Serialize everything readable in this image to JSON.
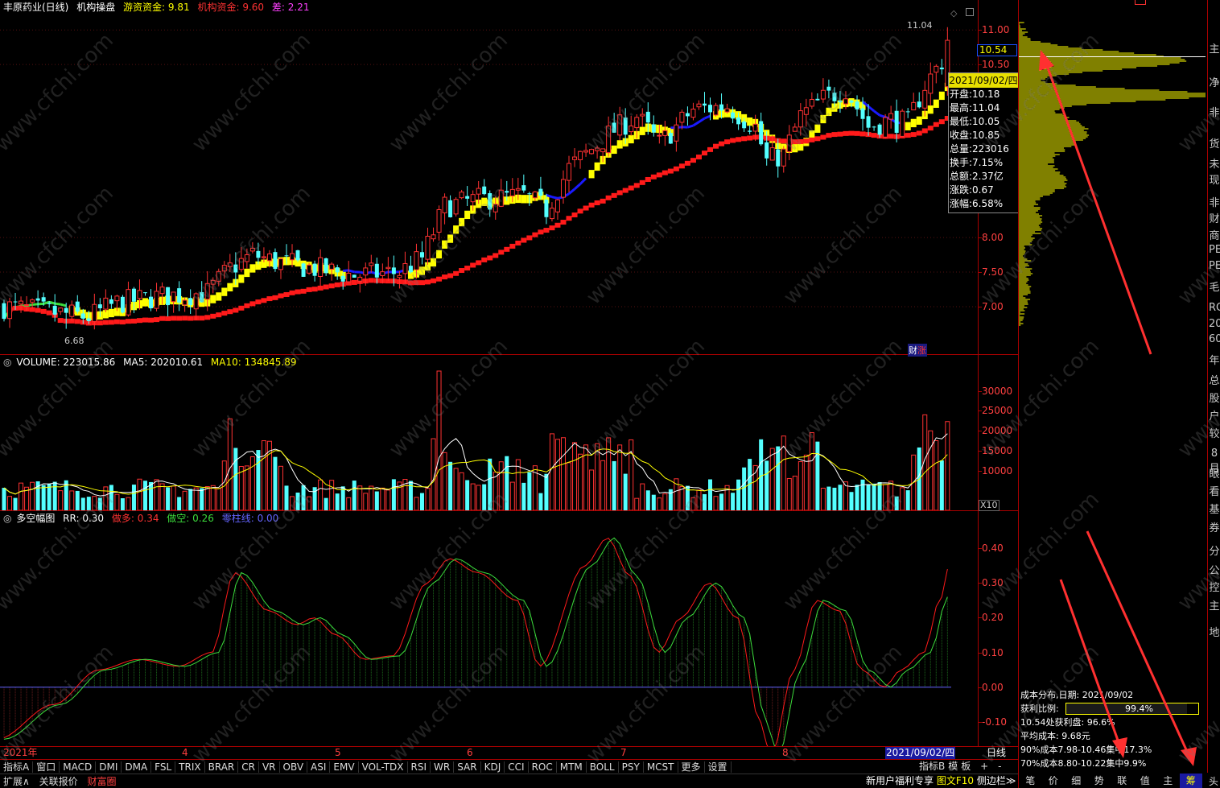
{
  "header": {
    "stock": "丰原药业(日线)",
    "indicator": "机构操盘",
    "hot_label": "游资资金:",
    "hot_value": "9.81",
    "inst_label": "机构资金:",
    "inst_value": "9.60",
    "diff_label": "差:",
    "diff_value": "2.21"
  },
  "price_axis": [
    "11.00",
    "10.50",
    "8.00",
    "7.50",
    "7.00"
  ],
  "price_marker": "10.54",
  "high_label": "11.04",
  "low_label": "6.68",
  "tag_cai": "财",
  "tag_zhang": "涨",
  "infobox": {
    "date": "2021/09/02/四",
    "rows": [
      "开盘:10.18",
      "最高:11.04",
      "最低:10.05",
      "收盘:10.85",
      "总量:223016",
      "换手:7.15%",
      "总额:2.37亿",
      "涨跌:0.67",
      "涨幅:6.58%"
    ]
  },
  "volume": {
    "title": "VOLUME: 223015.86",
    "ma5": "MA5: 202010.61",
    "ma10": "MA10: 134845.89",
    "axis": [
      "30000",
      "25000",
      "20000",
      "15000",
      "10000"
    ],
    "unit": "X10"
  },
  "osc": {
    "title": "多空幅图",
    "rr": "RR: 0.30",
    "long_label": "做多:",
    "long_value": "0.34",
    "short_label": "做空:",
    "short_value": "0.26",
    "zero_label": "零柱线:",
    "zero_value": "0.00",
    "axis": [
      "0.40",
      "0.30",
      "0.20",
      "0.10",
      "0.00",
      "-0.10"
    ]
  },
  "dates": {
    "year": "2021年",
    "m4": "4",
    "m5": "5",
    "m6": "6",
    "m7": "7",
    "m8": "8",
    "current": "2021/09/02/四",
    "unit": "日线"
  },
  "bottom_tabs": [
    "指标A",
    "窗口",
    "MACD",
    "DMI",
    "DMA",
    "FSL",
    "TRIX",
    "BRAR",
    "CR",
    "VR",
    "OBV",
    "ASI",
    "EMV",
    "VOL-TDX",
    "RSI",
    "WR",
    "SAR",
    "KDJ",
    "CCI",
    "ROC",
    "MTM",
    "BOLL",
    "PSY",
    "MCST",
    "更多",
    "设置"
  ],
  "bottom_right": [
    "指标B",
    "模",
    "板"
  ],
  "status_items": [
    "扩展∧",
    "关联报价",
    "财富圈"
  ],
  "status_right": [
    "新用户福利专享",
    "图文F10",
    "侧边栏≫"
  ],
  "cost": {
    "title": "成本分布,日期: 2021/09/02",
    "profit_label": "获利比例:",
    "profit_value": "99.4%",
    "line3": "10.54处获利盘: 96.6%",
    "line4": "平均成本: 9.68元",
    "line5": "90%成本7.98-10.46集中17.3%",
    "line6": "70%成本8.80-10.22集中9.9%"
  },
  "side_chars": [
    "主",
    "净",
    "非",
    "货",
    "未",
    "现",
    "非",
    "财",
    "商",
    "PE",
    "PE",
    "毛",
    "RO",
    "20",
    "60",
    "年",
    "总",
    "股",
    "户",
    "较",
    "8月",
    "眼",
    "看",
    "基",
    "券",
    "分",
    "公",
    "控",
    "主",
    "地"
  ],
  "right_tabs": [
    "笔",
    "价",
    "细",
    "势",
    "联",
    "值",
    "主",
    "筹"
  ],
  "right_end": "头",
  "watermark": "www.cfchi.com",
  "colors": {
    "up": "#ff3232",
    "down": "#54ffff",
    "yellow": "#ffff00",
    "red": "#ff1a1a",
    "blue": "#1a1aff",
    "green": "#3cdc3c",
    "axis": "#aa0000"
  },
  "chart_data": {
    "type": "candlestick",
    "ylim": [
      6.5,
      11.2
    ],
    "price_labels": [
      11.0,
      10.5,
      8.0,
      7.5,
      7.0
    ],
    "high": 11.04,
    "low": 6.68,
    "current": 10.54,
    "volume_ylim": [
      0,
      35000
    ],
    "volume_ticks": [
      30000,
      25000,
      20000,
      15000,
      10000
    ],
    "osc_ylim": [
      -0.17,
      0.47
    ],
    "osc_ticks": [
      0.4,
      0.3,
      0.2,
      0.1,
      0.0,
      -0.1
    ]
  }
}
